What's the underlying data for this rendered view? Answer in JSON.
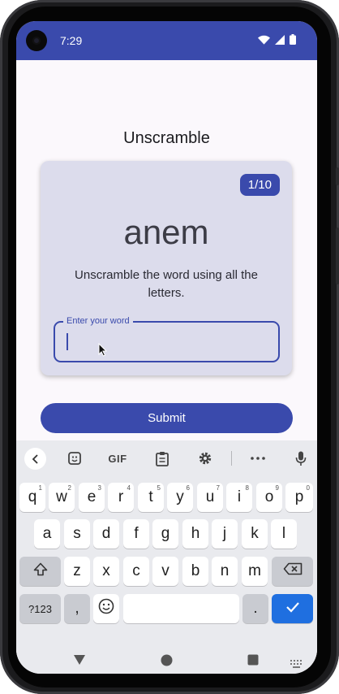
{
  "status_bar": {
    "time": "7:29",
    "icons": [
      "wifi-icon",
      "signal-icon",
      "battery-icon"
    ]
  },
  "app": {
    "title": "Unscramble",
    "counter": "1/10",
    "scrambled_word": "anem",
    "instructions": "Unscramble the word using all the letters.",
    "input": {
      "label": "Enter your word",
      "value": ""
    },
    "submit_label": "Submit"
  },
  "keyboard": {
    "toolbar": {
      "gif_label": "GIF",
      "items": [
        "back-icon",
        "sticker-icon",
        "gif-button",
        "clipboard-icon",
        "gear-icon",
        "more-icon",
        "mic-icon"
      ]
    },
    "row1": [
      {
        "key": "q",
        "hint": "1"
      },
      {
        "key": "w",
        "hint": "2"
      },
      {
        "key": "e",
        "hint": "3"
      },
      {
        "key": "r",
        "hint": "4"
      },
      {
        "key": "t",
        "hint": "5"
      },
      {
        "key": "y",
        "hint": "6"
      },
      {
        "key": "u",
        "hint": "7"
      },
      {
        "key": "i",
        "hint": "8"
      },
      {
        "key": "o",
        "hint": "9"
      },
      {
        "key": "p",
        "hint": "0"
      }
    ],
    "row2": [
      "a",
      "s",
      "d",
      "f",
      "g",
      "h",
      "j",
      "k",
      "l"
    ],
    "row3": [
      "z",
      "x",
      "c",
      "v",
      "b",
      "n",
      "m"
    ],
    "row4": {
      "symbols": "?123",
      "comma": ",",
      "period": "."
    }
  },
  "colors": {
    "primary": "#3a4aac",
    "card": "#dcdcec",
    "background": "#fbf8fc",
    "keyboard_action": "#1f6fe0"
  }
}
